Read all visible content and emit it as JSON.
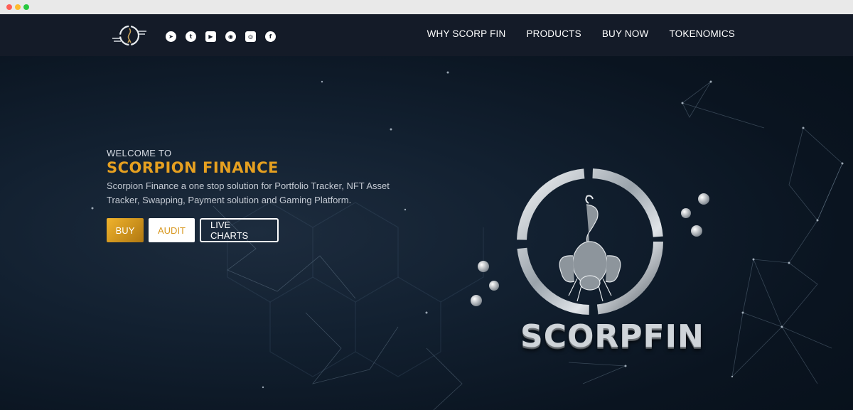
{
  "browser": {
    "controls": [
      "close",
      "minimize",
      "maximize"
    ]
  },
  "navbar": {
    "logo_icon": "scorpion-logo-icon",
    "social": [
      {
        "name": "telegram-icon",
        "glyph": "➤"
      },
      {
        "name": "twitter-icon",
        "glyph": "t"
      },
      {
        "name": "youtube-icon",
        "glyph": "▶"
      },
      {
        "name": "reddit-icon",
        "glyph": "◉"
      },
      {
        "name": "instagram-icon",
        "glyph": "◎"
      },
      {
        "name": "facebook-icon",
        "glyph": "f"
      }
    ],
    "menu": [
      "WHY SCORP FIN",
      "PRODUCTS",
      "BUY NOW",
      "TOKENOMICS"
    ]
  },
  "hero": {
    "welcome": "WELCOME TO",
    "brand": "SCORPION FINANCE",
    "description": "Scorpion Finance a one stop solution for Portfolio Tracker, NFT Asset Tracker, Swapping, Payment solution and Gaming Platform.",
    "buttons": {
      "buy": "BUY",
      "audit": "AUDIT",
      "live_charts": "LIVE CHARTS"
    },
    "wordmark": "SCORPFIN",
    "emblem_icon": "scorpion-emblem-icon"
  },
  "colors": {
    "accent": "#e6a020",
    "navbar": "#141b28",
    "background": "#0f1c2a"
  }
}
